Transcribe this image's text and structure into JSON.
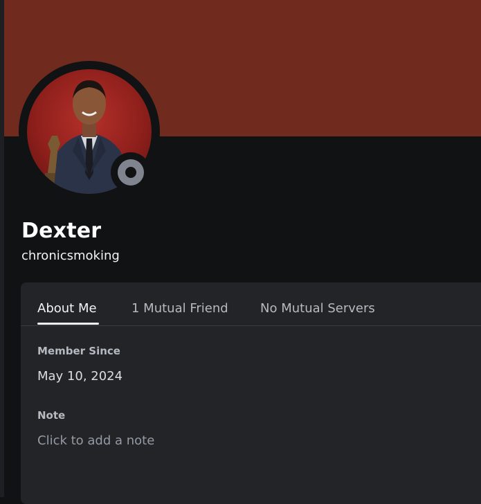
{
  "profile": {
    "display_name": "Dexter",
    "username": "chronicsmoking",
    "status": "offline",
    "banner_color": "#702b1e"
  },
  "tabs": [
    {
      "label": "About Me",
      "active": true
    },
    {
      "label": "1 Mutual Friend",
      "active": false
    },
    {
      "label": "No Mutual Servers",
      "active": false
    }
  ],
  "about": {
    "member_since_title": "Member Since",
    "member_since_value": "May 10, 2024",
    "note_title": "Note",
    "note_placeholder": "Click to add a note"
  },
  "colors": {
    "background": "#111214",
    "panel": "#232428",
    "status_offline": "#80848e"
  }
}
